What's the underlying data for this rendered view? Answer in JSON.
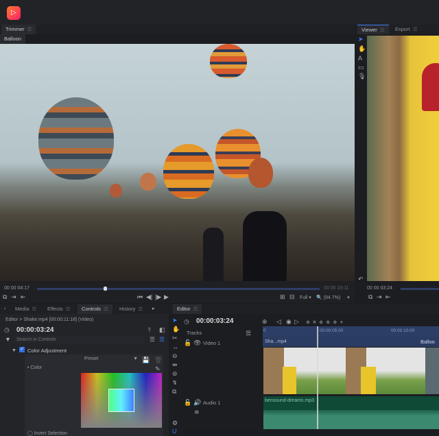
{
  "app": {
    "logo": "play-logo",
    "accent": "#3d7ef5"
  },
  "trimmer": {
    "tab": "Trimmer",
    "clip_tab": "Balloon",
    "timecode": "00 00 04:17",
    "duration": "00 00 19:11",
    "progress": 0.22,
    "quality": "Full",
    "zoom": "(94.7%)"
  },
  "viewer": {
    "tabs": [
      "Viewer",
      "Export"
    ],
    "timecode": "00 00 03:24"
  },
  "panels": {
    "tabs": [
      "Media",
      "Effects",
      "Controls",
      "History"
    ],
    "active": "Controls"
  },
  "controls": {
    "breadcrumb": "Editor > Shake.mp4 [00:00:11:18] (Video)",
    "timecode": "00:00:03:24",
    "search_placeholder": "Search in Controls",
    "effect": "Color Adjustment",
    "preset": "Preset",
    "color_label": "Color",
    "invert": "Invert Selection"
  },
  "editor": {
    "tab": "Editor",
    "timecode": "00:00:03:24",
    "tracks_label": "Tracks",
    "video_track": "Video 1",
    "audio_track": "Audio 1",
    "ruler": [
      "0",
      "00:00:05:00",
      "00:00:10:00"
    ],
    "video_clip": "Sha...mp4",
    "video_clip2": "Balloo",
    "audio_clip": "bensound-dreams.mp3"
  }
}
